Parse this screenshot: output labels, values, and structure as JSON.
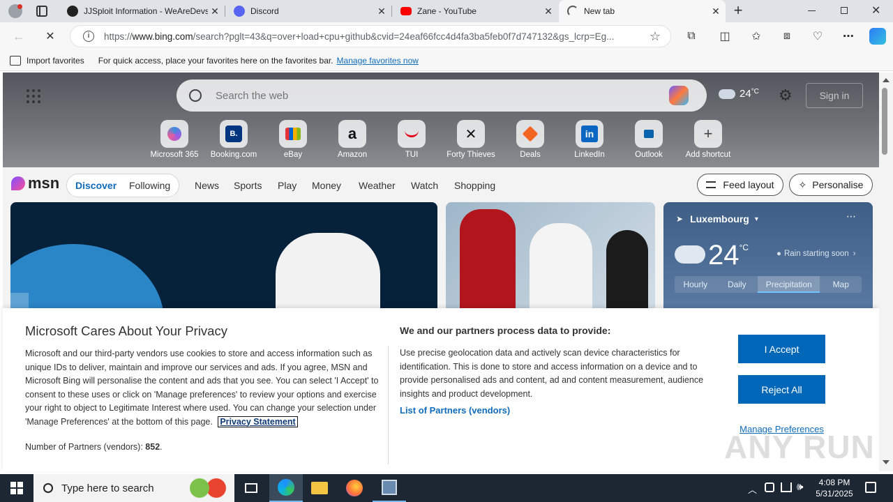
{
  "tabs": [
    {
      "title": "JJSploit Information - WeAreDevs",
      "icon": "wearedevs-icon"
    },
    {
      "title": "Discord",
      "icon": "discord-icon"
    },
    {
      "title": "Zane - YouTube",
      "icon": "youtube-icon"
    },
    {
      "title": "New tab",
      "icon": "loading-icon",
      "active": true
    }
  ],
  "address": {
    "url_prefix": "https://",
    "url_domain": "www.bing.com",
    "url_rest": "/search?pglt=43&q=over+load+cpu+github&cvid=24eaf66fcc4d4fa3ba5feb0f7d747132&gs_lcrp=Eg..."
  },
  "favorites_bar": {
    "import_label": "Import favorites",
    "hint": "For quick access, place your favorites here on the favorites bar.",
    "manage_link": "Manage favorites now"
  },
  "search": {
    "placeholder": "Search the web"
  },
  "weather_header": {
    "temp": "24",
    "unit": "°C"
  },
  "sign_in": "Sign in",
  "shortcuts": [
    {
      "label": "Microsoft 365"
    },
    {
      "label": "Booking.com",
      "glyph": "B."
    },
    {
      "label": "eBay"
    },
    {
      "label": "Amazon",
      "glyph": "a"
    },
    {
      "label": "TUI"
    },
    {
      "label": "Forty Thieves"
    },
    {
      "label": "Deals"
    },
    {
      "label": "LinkedIn",
      "glyph": "in"
    },
    {
      "label": "Outlook"
    },
    {
      "label": "Add shortcut",
      "glyph": "+"
    }
  ],
  "msn": {
    "logo": "msn",
    "toggle": [
      "Discover",
      "Following"
    ],
    "nav": [
      "News",
      "Sports",
      "Play",
      "Money",
      "Weather",
      "Watch",
      "Shopping"
    ],
    "feed_layout": "Feed layout",
    "personalise": "Personalise"
  },
  "weather_card": {
    "location": "Luxembourg",
    "temp": "24",
    "unit": "°C",
    "status": "Rain starting soon",
    "tabs": [
      "Hourly",
      "Daily",
      "Precipitation",
      "Map"
    ],
    "active_tab": "Precipitation"
  },
  "consent": {
    "title": "Microsoft Cares About Your Privacy",
    "body": "Microsoft and our third-party vendors use cookies to store and access information such as unique IDs to deliver, maintain and improve our services and ads. If you agree, MSN and Microsoft Bing will personalise the content and ads that you see. You can select 'I Accept' to consent to these uses or click on 'Manage preferences' to review your options and exercise your right to object to Legitimate Interest where used. You can change your selection under 'Manage Preferences' at the bottom of this page.",
    "privacy_link": "Privacy Statement",
    "partners_label": "Number of Partners (vendors):",
    "partners_count": "852",
    "partners_suffix": ".",
    "right_title": "We and our partners process data to provide:",
    "right_body": "Use precise geolocation data and actively scan device characteristics for identification. This is done to store and access information on a device and to provide personalised ads and content, ad and content measurement, audience insights and product development.",
    "vendors_link": "List of Partners (vendors)",
    "accept": "I Accept",
    "reject": "Reject All",
    "manage": "Manage Preferences"
  },
  "watermark": "ANY RUN",
  "taskbar": {
    "search_placeholder": "Type here to search",
    "time": "4:08 PM",
    "date": "5/31/2025"
  },
  "colors": {
    "accent": "#0067b8",
    "link": "#0f6cbd",
    "taskbar": "#1c2733"
  }
}
